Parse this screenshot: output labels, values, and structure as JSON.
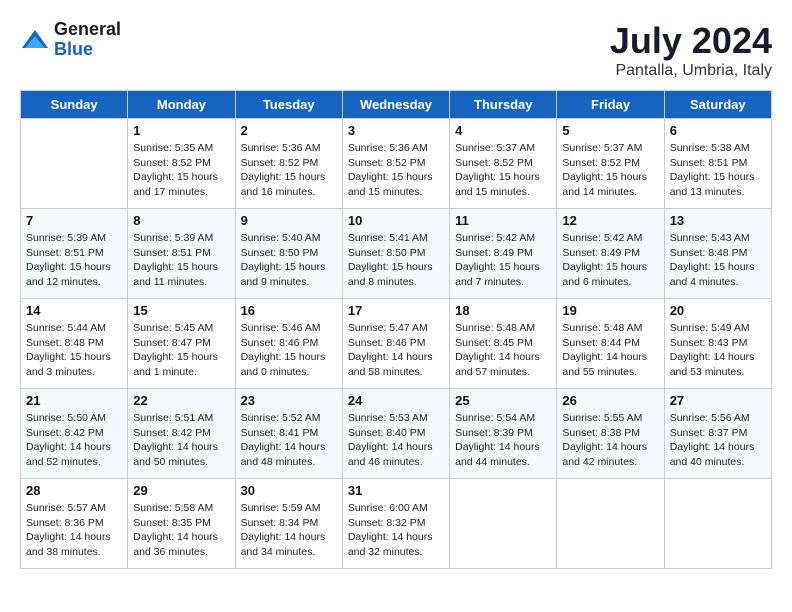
{
  "header": {
    "logo_line1": "General",
    "logo_line2": "Blue",
    "month_year": "July 2024",
    "location": "Pantalla, Umbria, Italy"
  },
  "columns": [
    "Sunday",
    "Monday",
    "Tuesday",
    "Wednesday",
    "Thursday",
    "Friday",
    "Saturday"
  ],
  "weeks": [
    [
      {
        "day": "",
        "info": ""
      },
      {
        "day": "1",
        "info": "Sunrise: 5:35 AM\nSunset: 8:52 PM\nDaylight: 15 hours\nand 17 minutes."
      },
      {
        "day": "2",
        "info": "Sunrise: 5:36 AM\nSunset: 8:52 PM\nDaylight: 15 hours\nand 16 minutes."
      },
      {
        "day": "3",
        "info": "Sunrise: 5:36 AM\nSunset: 8:52 PM\nDaylight: 15 hours\nand 15 minutes."
      },
      {
        "day": "4",
        "info": "Sunrise: 5:37 AM\nSunset: 8:52 PM\nDaylight: 15 hours\nand 15 minutes."
      },
      {
        "day": "5",
        "info": "Sunrise: 5:37 AM\nSunset: 8:52 PM\nDaylight: 15 hours\nand 14 minutes."
      },
      {
        "day": "6",
        "info": "Sunrise: 5:38 AM\nSunset: 8:51 PM\nDaylight: 15 hours\nand 13 minutes."
      }
    ],
    [
      {
        "day": "7",
        "info": "Sunrise: 5:39 AM\nSunset: 8:51 PM\nDaylight: 15 hours\nand 12 minutes."
      },
      {
        "day": "8",
        "info": "Sunrise: 5:39 AM\nSunset: 8:51 PM\nDaylight: 15 hours\nand 11 minutes."
      },
      {
        "day": "9",
        "info": "Sunrise: 5:40 AM\nSunset: 8:50 PM\nDaylight: 15 hours\nand 9 minutes."
      },
      {
        "day": "10",
        "info": "Sunrise: 5:41 AM\nSunset: 8:50 PM\nDaylight: 15 hours\nand 8 minutes."
      },
      {
        "day": "11",
        "info": "Sunrise: 5:42 AM\nSunset: 8:49 PM\nDaylight: 15 hours\nand 7 minutes."
      },
      {
        "day": "12",
        "info": "Sunrise: 5:42 AM\nSunset: 8:49 PM\nDaylight: 15 hours\nand 6 minutes."
      },
      {
        "day": "13",
        "info": "Sunrise: 5:43 AM\nSunset: 8:48 PM\nDaylight: 15 hours\nand 4 minutes."
      }
    ],
    [
      {
        "day": "14",
        "info": "Sunrise: 5:44 AM\nSunset: 8:48 PM\nDaylight: 15 hours\nand 3 minutes."
      },
      {
        "day": "15",
        "info": "Sunrise: 5:45 AM\nSunset: 8:47 PM\nDaylight: 15 hours\nand 1 minute."
      },
      {
        "day": "16",
        "info": "Sunrise: 5:46 AM\nSunset: 8:46 PM\nDaylight: 15 hours\nand 0 minutes."
      },
      {
        "day": "17",
        "info": "Sunrise: 5:47 AM\nSunset: 8:46 PM\nDaylight: 14 hours\nand 58 minutes."
      },
      {
        "day": "18",
        "info": "Sunrise: 5:48 AM\nSunset: 8:45 PM\nDaylight: 14 hours\nand 57 minutes."
      },
      {
        "day": "19",
        "info": "Sunrise: 5:48 AM\nSunset: 8:44 PM\nDaylight: 14 hours\nand 55 minutes."
      },
      {
        "day": "20",
        "info": "Sunrise: 5:49 AM\nSunset: 8:43 PM\nDaylight: 14 hours\nand 53 minutes."
      }
    ],
    [
      {
        "day": "21",
        "info": "Sunrise: 5:50 AM\nSunset: 8:42 PM\nDaylight: 14 hours\nand 52 minutes."
      },
      {
        "day": "22",
        "info": "Sunrise: 5:51 AM\nSunset: 8:42 PM\nDaylight: 14 hours\nand 50 minutes."
      },
      {
        "day": "23",
        "info": "Sunrise: 5:52 AM\nSunset: 8:41 PM\nDaylight: 14 hours\nand 48 minutes."
      },
      {
        "day": "24",
        "info": "Sunrise: 5:53 AM\nSunset: 8:40 PM\nDaylight: 14 hours\nand 46 minutes."
      },
      {
        "day": "25",
        "info": "Sunrise: 5:54 AM\nSunset: 8:39 PM\nDaylight: 14 hours\nand 44 minutes."
      },
      {
        "day": "26",
        "info": "Sunrise: 5:55 AM\nSunset: 8:38 PM\nDaylight: 14 hours\nand 42 minutes."
      },
      {
        "day": "27",
        "info": "Sunrise: 5:56 AM\nSunset: 8:37 PM\nDaylight: 14 hours\nand 40 minutes."
      }
    ],
    [
      {
        "day": "28",
        "info": "Sunrise: 5:57 AM\nSunset: 8:36 PM\nDaylight: 14 hours\nand 38 minutes."
      },
      {
        "day": "29",
        "info": "Sunrise: 5:58 AM\nSunset: 8:35 PM\nDaylight: 14 hours\nand 36 minutes."
      },
      {
        "day": "30",
        "info": "Sunrise: 5:59 AM\nSunset: 8:34 PM\nDaylight: 14 hours\nand 34 minutes."
      },
      {
        "day": "31",
        "info": "Sunrise: 6:00 AM\nSunset: 8:32 PM\nDaylight: 14 hours\nand 32 minutes."
      },
      {
        "day": "",
        "info": ""
      },
      {
        "day": "",
        "info": ""
      },
      {
        "day": "",
        "info": ""
      }
    ]
  ]
}
